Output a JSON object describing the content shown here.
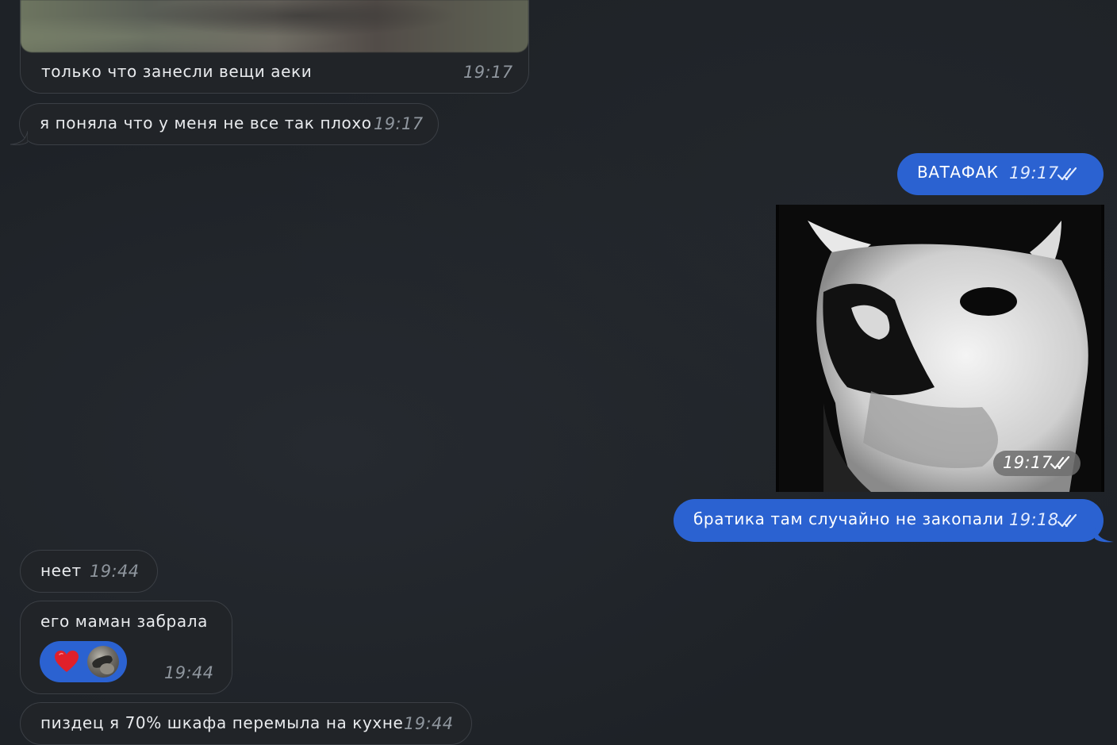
{
  "messages": [
    {
      "id": "m1",
      "direction": "incoming",
      "text": "только что занесли вещи аеки",
      "time": "19:17",
      "has_photo": true
    },
    {
      "id": "m2",
      "direction": "incoming",
      "text": "я поняла что у меня не все так плохо",
      "time": "19:17"
    },
    {
      "id": "m3",
      "direction": "outgoing",
      "text": "ВАТАФАК",
      "time": "19:17",
      "status": "read"
    },
    {
      "id": "m4",
      "direction": "outgoing",
      "type": "sticker",
      "time": "19:17",
      "status": "read"
    },
    {
      "id": "m5",
      "direction": "outgoing",
      "text": "братика там случайно не закопали",
      "time": "19:18",
      "status": "read"
    },
    {
      "id": "m6",
      "direction": "incoming",
      "text": "неет",
      "time": "19:44"
    },
    {
      "id": "m7",
      "direction": "incoming",
      "text": "его маман забрала",
      "time": "19:44",
      "reaction": "heart"
    },
    {
      "id": "m8",
      "direction": "incoming",
      "text": "пиздец я 70% шкафа перемыла на кухне",
      "time": "19:44"
    }
  ],
  "colors": {
    "background": "#1e2227",
    "incoming_bubble": "#212428",
    "outgoing_bubble": "#2b62d1",
    "reaction": "#e0202a"
  },
  "icons": [
    "double-check-icon",
    "heart-icon",
    "avatar"
  ]
}
